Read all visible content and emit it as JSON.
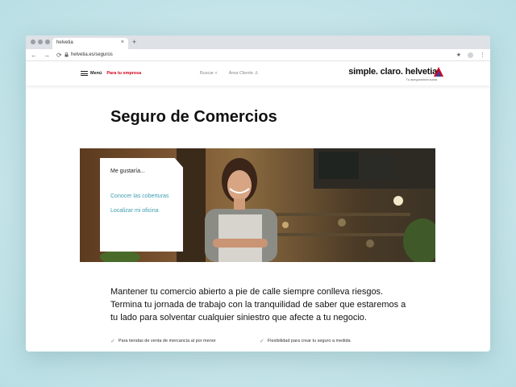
{
  "browser": {
    "tab_title": "helvetia",
    "tab_close": "×",
    "new_tab": "+",
    "back": "←",
    "forward": "→",
    "reload": "⟳",
    "url": "helvetia.es/seguros",
    "star": "★",
    "more": "⋮"
  },
  "header": {
    "menu_label": "Menú",
    "business_link": "Para tu empresa",
    "search_label": "Buscar",
    "client_area_label": "Área Cliente",
    "slogan": "simple. claro. helvetia",
    "tagline": "Tu aseguradora suiza",
    "brand_colors": [
      "#d0021b",
      "#6b2d8f",
      "#1a4f9c"
    ]
  },
  "page": {
    "title": "Seguro de Comercios",
    "hero_card": {
      "heading": "Me gustaría...",
      "links": [
        "Conocer las coberturas",
        "Localizar mi oficina"
      ]
    },
    "intro_lines": [
      "Mantener tu comercio abierto a pie de calle siempre conlleva riesgos.",
      "Termina tu jornada de trabajo con la tranquilidad de saber que estaremos a",
      "tu lado para solventar cualquier siniestro que afecte a tu negocio."
    ],
    "features": [
      "Para tiendas de venta de mercancía al por menor",
      "Flexibilidad para crear tu seguro a medida"
    ]
  }
}
